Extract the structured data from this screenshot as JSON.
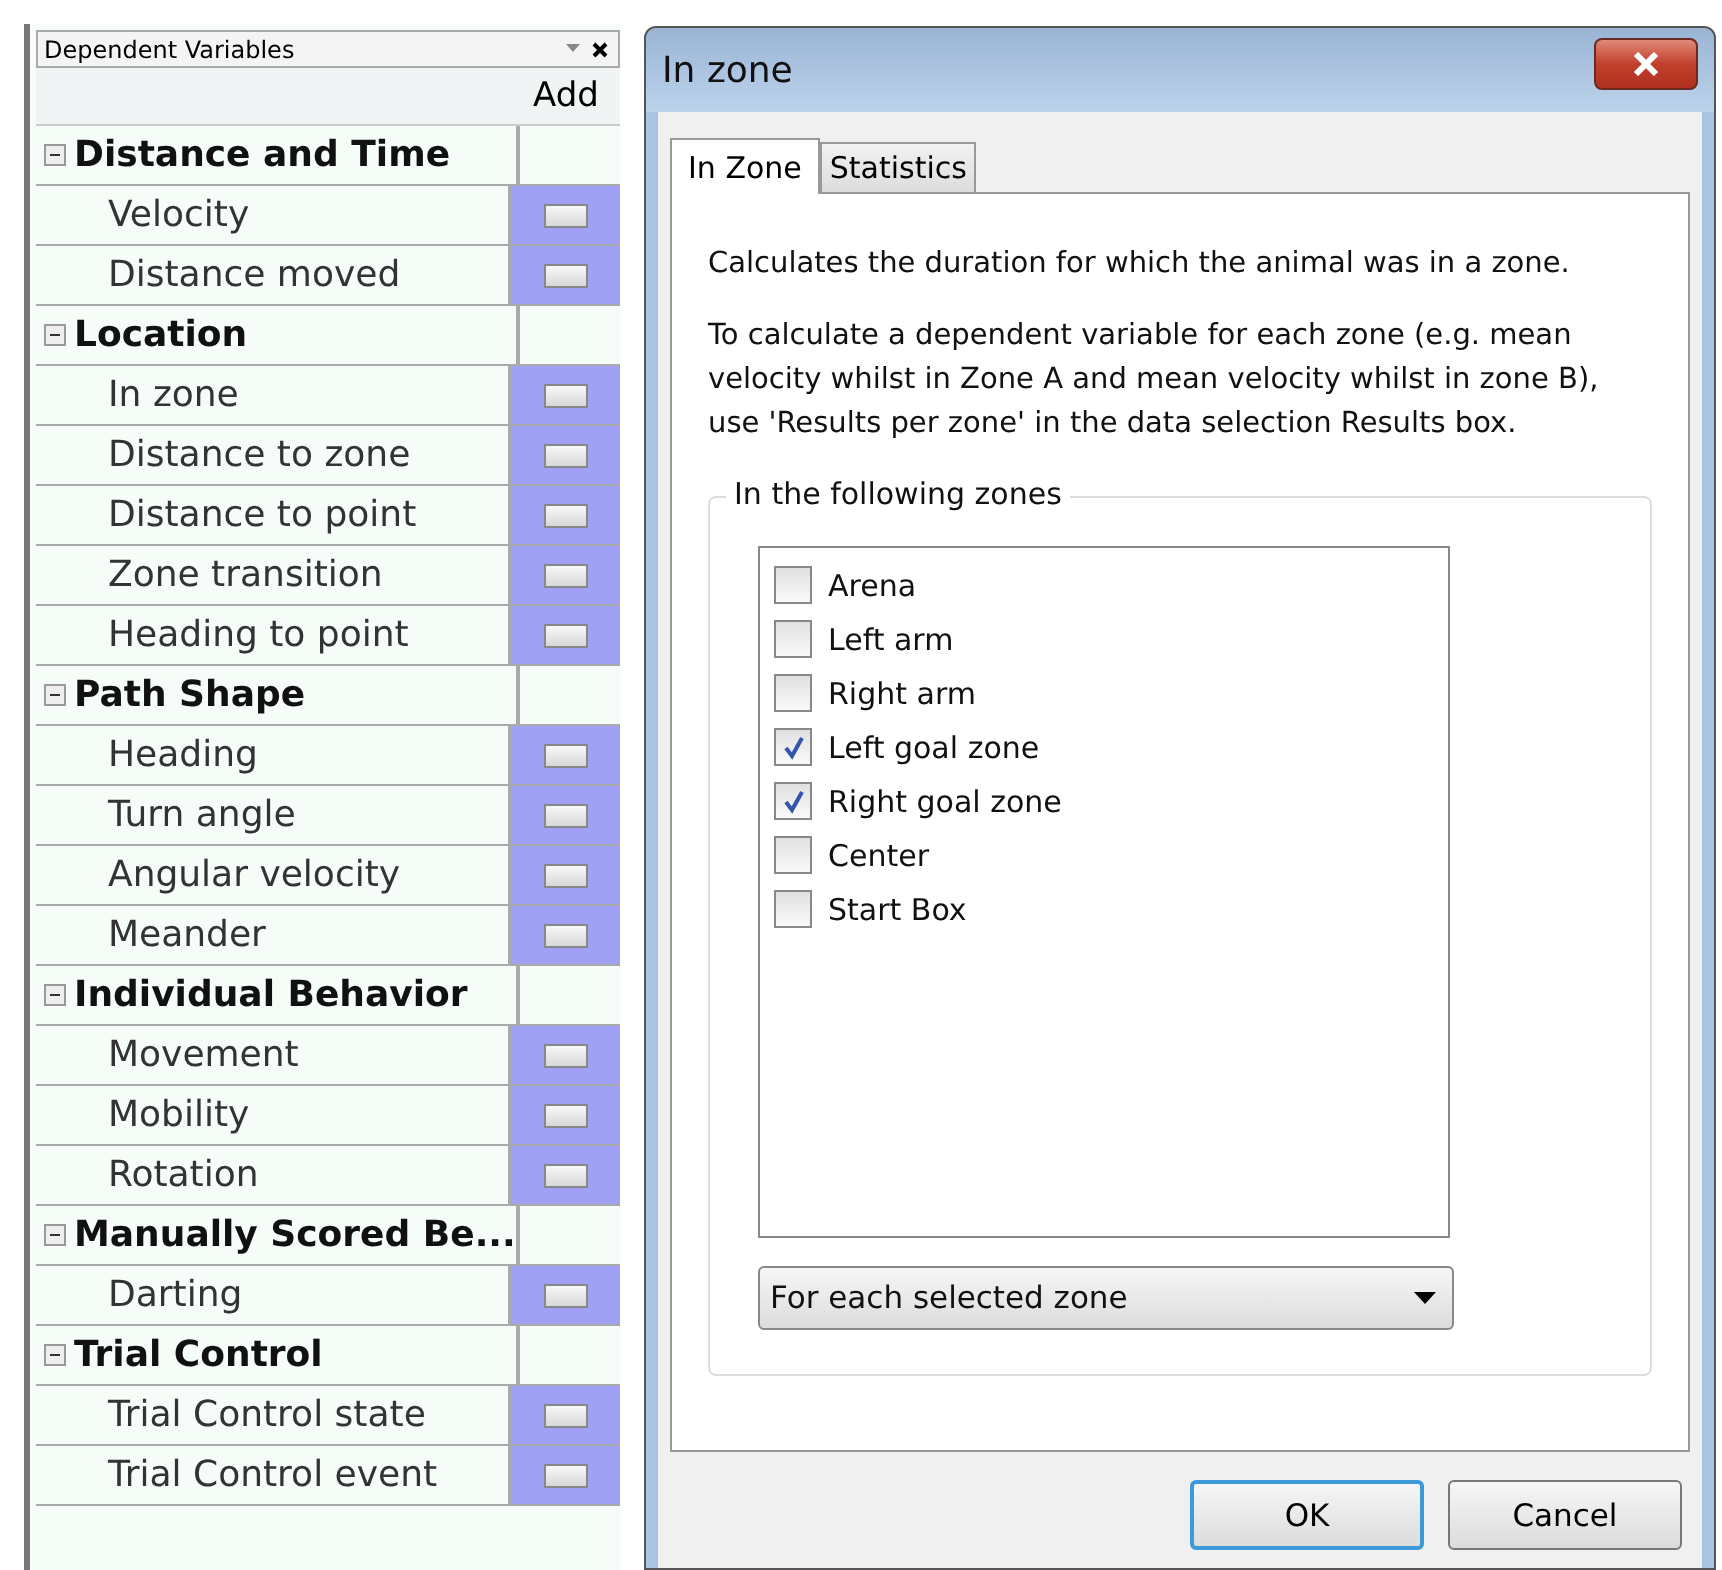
{
  "panel": {
    "title": "Dependent Variables",
    "add_column": "Add",
    "groups": [
      {
        "name": "Distance and Time",
        "expanded": true,
        "items": [
          "Velocity",
          "Distance moved"
        ]
      },
      {
        "name": "Location",
        "expanded": true,
        "items": [
          "In zone",
          "Distance to zone",
          "Distance to point",
          "Zone transition",
          "Heading to point"
        ]
      },
      {
        "name": "Path Shape",
        "expanded": true,
        "items": [
          "Heading",
          "Turn angle",
          "Angular velocity",
          "Meander"
        ]
      },
      {
        "name": "Individual Behavior",
        "expanded": true,
        "items": [
          "Movement",
          "Mobility",
          "Rotation"
        ]
      },
      {
        "name": "Manually Scored Be...",
        "expanded": true,
        "items": [
          "Darting"
        ]
      },
      {
        "name": "Trial Control",
        "expanded": true,
        "items": [
          "Trial Control state",
          "Trial Control event"
        ]
      }
    ]
  },
  "dialog": {
    "title": "In zone",
    "tabs": [
      {
        "label": "In Zone",
        "selected": true
      },
      {
        "label": "Statistics",
        "selected": false
      }
    ],
    "description": "Calculates the duration for which the animal was in a zone.",
    "hint": "To calculate a dependent variable for each zone (e.g. mean velocity whilst in Zone A and mean velocity whilst in zone B), use 'Results per zone' in the data selection Results box.",
    "zones_group": "In the following zones",
    "zones": [
      {
        "label": "Arena",
        "checked": false
      },
      {
        "label": "Left arm",
        "checked": false
      },
      {
        "label": "Right arm",
        "checked": false
      },
      {
        "label": "Left goal zone",
        "checked": true
      },
      {
        "label": "Right goal zone",
        "checked": true
      },
      {
        "label": "Center",
        "checked": false
      },
      {
        "label": "Start Box",
        "checked": false
      }
    ],
    "mode": "For each selected zone",
    "buttons": [
      "OK",
      "Cancel"
    ]
  }
}
